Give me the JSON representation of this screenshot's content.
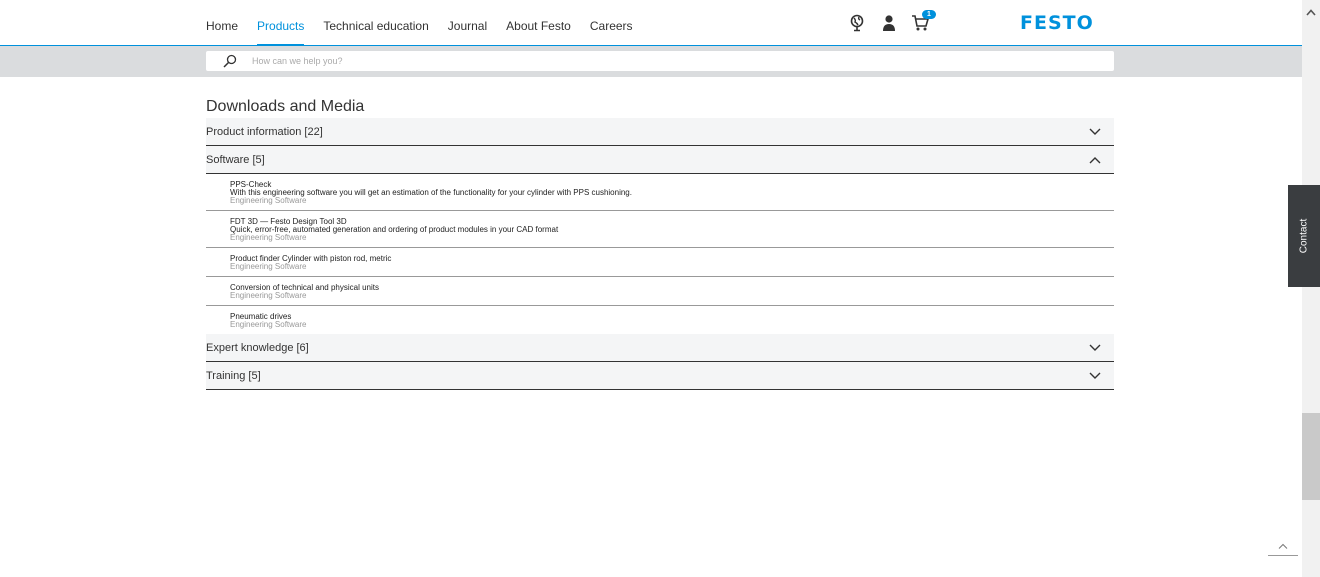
{
  "header": {
    "nav": [
      {
        "label": "Home",
        "active": false
      },
      {
        "label": "Products",
        "active": true
      },
      {
        "label": "Technical education",
        "active": false
      },
      {
        "label": "Journal",
        "active": false
      },
      {
        "label": "About Festo",
        "active": false
      },
      {
        "label": "Careers",
        "active": false
      }
    ],
    "icons": [
      "globe-icon",
      "user-icon",
      "cart-icon"
    ],
    "cart_count": "1",
    "logo_text": "FESTO",
    "accent_color": "#0091dc"
  },
  "search": {
    "placeholder": "How can we help you?"
  },
  "main": {
    "title": "Downloads and Media",
    "sections": [
      {
        "label": "Product information [22]",
        "expanded": false
      },
      {
        "label": "Software [5]",
        "expanded": true,
        "items": [
          {
            "title": "PPS-Check",
            "desc": "With this engineering software you will get an estimation of the functionality for your cylinder with PPS cushioning.",
            "category": "Engineering Software"
          },
          {
            "title": "FDT 3D — Festo Design Tool 3D",
            "desc": "Quick, error-free, automated generation and ordering of product modules in your CAD format",
            "category": "Engineering Software"
          },
          {
            "title": "Product finder Cylinder with piston rod, metric",
            "desc": "",
            "category": "Engineering Software"
          },
          {
            "title": "Conversion of technical and physical units",
            "desc": "",
            "category": "Engineering Software"
          },
          {
            "title": "Pneumatic drives",
            "desc": "",
            "category": "Engineering Software"
          }
        ]
      },
      {
        "label": "Expert knowledge [6]",
        "expanded": false
      },
      {
        "label": "Training [5]",
        "expanded": false
      }
    ]
  },
  "contact": {
    "label": "Contact"
  }
}
